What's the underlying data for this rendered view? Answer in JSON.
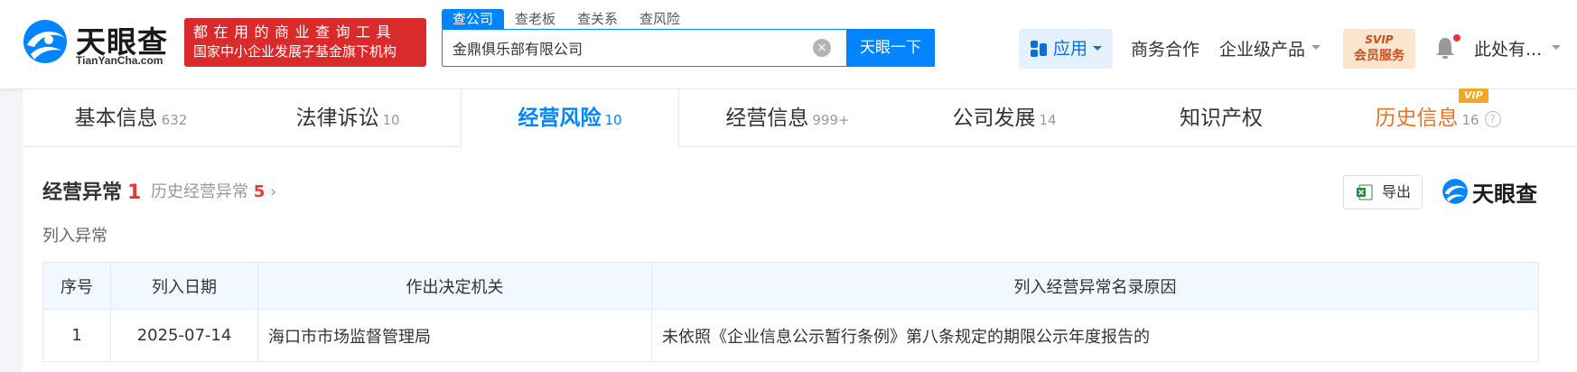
{
  "brand": {
    "name_cn": "天眼查",
    "name_en": "TianYanCha.com",
    "slogan_line1": "都在用的商业查询工具",
    "slogan_line2": "国家中小企业发展子基金旗下机构",
    "colors": {
      "primary": "#0084ff",
      "slogan_bg": "#d92b2b",
      "accent_orange": "#e8741f",
      "risk_red": "#e53935"
    }
  },
  "search": {
    "tabs": [
      "查公司",
      "查老板",
      "查关系",
      "查风险"
    ],
    "query": "金鼎俱乐部有限公司",
    "button": "天眼一下"
  },
  "nav": {
    "app": "应用",
    "business": "商务合作",
    "enterprise": "企业级产品",
    "svip_top": "SVIP",
    "svip_bottom": "会员服务",
    "user": "此处有..."
  },
  "tabs": [
    {
      "label": "基本信息",
      "count": "632"
    },
    {
      "label": "法律诉讼",
      "count": "10"
    },
    {
      "label": "经营风险",
      "count": "10"
    },
    {
      "label": "经营信息",
      "count": "999+"
    },
    {
      "label": "公司发展",
      "count": "14"
    },
    {
      "label": "知识产权",
      "count": ""
    },
    {
      "label": "历史信息",
      "count": "16",
      "badge": "VIP"
    }
  ],
  "section": {
    "title": "经营异常",
    "count": "1",
    "history_label": "历史经营异常",
    "history_count": "5",
    "export": "导出",
    "watermark": "天眼查",
    "list_label": "列入异常"
  },
  "table": {
    "headers": [
      "序号",
      "列入日期",
      "作出决定机关",
      "列入经营异常名录原因"
    ],
    "rows": [
      [
        "1",
        "2025-07-14",
        "海口市市场监督管理局",
        "未依照《企业信息公示暂行条例》第八条规定的期限公示年度报告的"
      ]
    ]
  }
}
